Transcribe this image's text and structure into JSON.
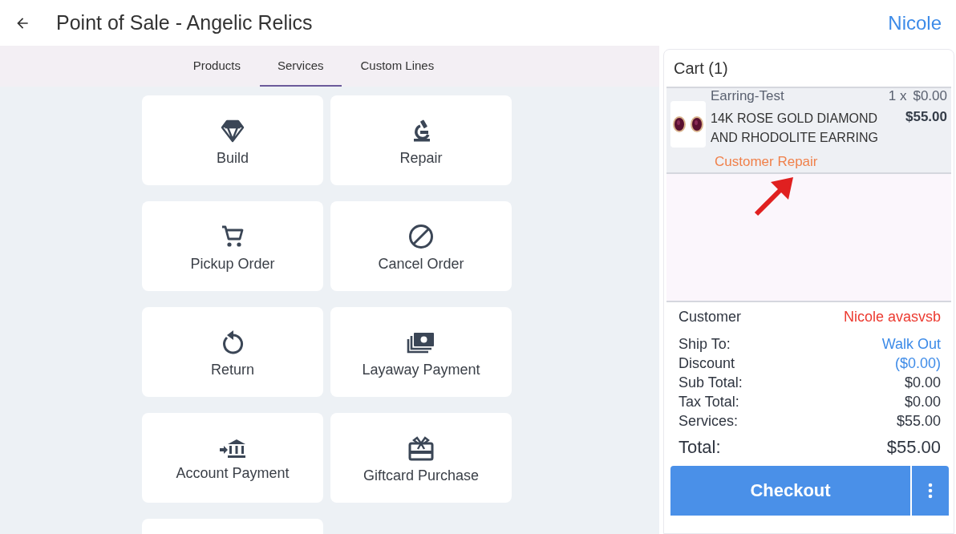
{
  "header": {
    "title": "Point of Sale - Angelic Relics",
    "user": "Nicole"
  },
  "tabs": [
    {
      "label": "Products",
      "selected": false
    },
    {
      "label": "Services",
      "selected": true
    },
    {
      "label": "Custom Lines",
      "selected": false
    }
  ],
  "services": [
    {
      "label": "Build"
    },
    {
      "label": "Repair"
    },
    {
      "label": "Pickup Order"
    },
    {
      "label": "Cancel Order"
    },
    {
      "label": "Return"
    },
    {
      "label": "Layaway Payment"
    },
    {
      "label": "Account Payment"
    },
    {
      "label": "Giftcard Purchase"
    }
  ],
  "cart": {
    "title": "Cart (1)",
    "items": [
      {
        "name": "Earring-Test",
        "quantity": "1 x",
        "unit_price": "$0.00",
        "description": "14K ROSE GOLD DIAMOND AND RHODOLITE EARRING",
        "price": "$55.00",
        "service": "Customer Repair"
      }
    ],
    "summary": [
      {
        "label": "Customer",
        "value": "Nicole avasvsb",
        "kind": "alert"
      },
      {
        "label": "Ship To:",
        "value": "Walk Out",
        "kind": "link"
      },
      {
        "label": "Discount",
        "value": "($0.00)",
        "kind": "link"
      },
      {
        "label": "Sub Total:",
        "value": "$0.00",
        "kind": "plain"
      },
      {
        "label": "Tax Total:",
        "value": "$0.00",
        "kind": "plain"
      },
      {
        "label": "Services:",
        "value": "$55.00",
        "kind": "plain"
      },
      {
        "label": "Total:",
        "value": "$55.00",
        "kind": "total"
      }
    ],
    "checkout": "Checkout"
  }
}
